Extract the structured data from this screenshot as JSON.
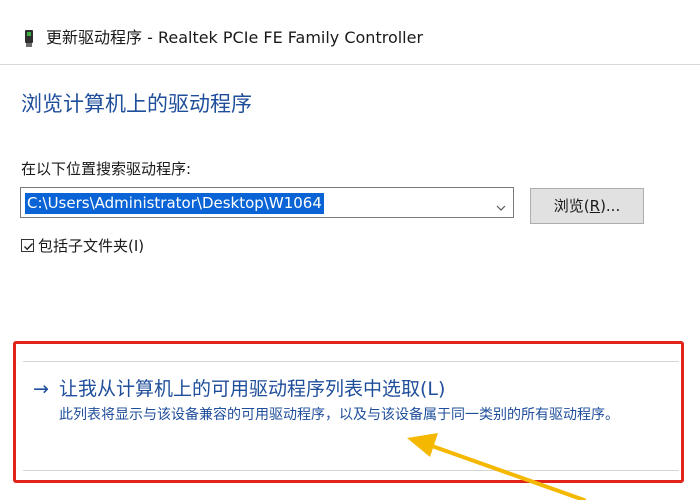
{
  "window": {
    "title": "更新驱动程序 - Realtek PCIe FE Family Controller",
    "icon": "network-adapter-icon"
  },
  "main": {
    "heading": "浏览计算机上的驱动程序",
    "search_label": "在以下位置搜索驱动程序:",
    "path_value": "C:\\Users\\Administrator\\Desktop\\W1064",
    "browse_button": {
      "label": "浏览(",
      "accel": "R",
      "suffix": ")..."
    },
    "include_subfolders": {
      "label": "包括子文件夹(I)",
      "checked": true
    }
  },
  "option": {
    "arrow": "→",
    "title": "让我从计算机上的可用驱动程序列表中选取(L)",
    "description": "此列表将显示与该设备兼容的可用驱动程序，以及与该设备属于同一类别的所有驱动程序。"
  },
  "colors": {
    "link_blue": "#1f4e9b",
    "highlight_red": "#e2231a",
    "annotation_yellow": "#f5b800",
    "selection_blue": "#0a64d6"
  }
}
